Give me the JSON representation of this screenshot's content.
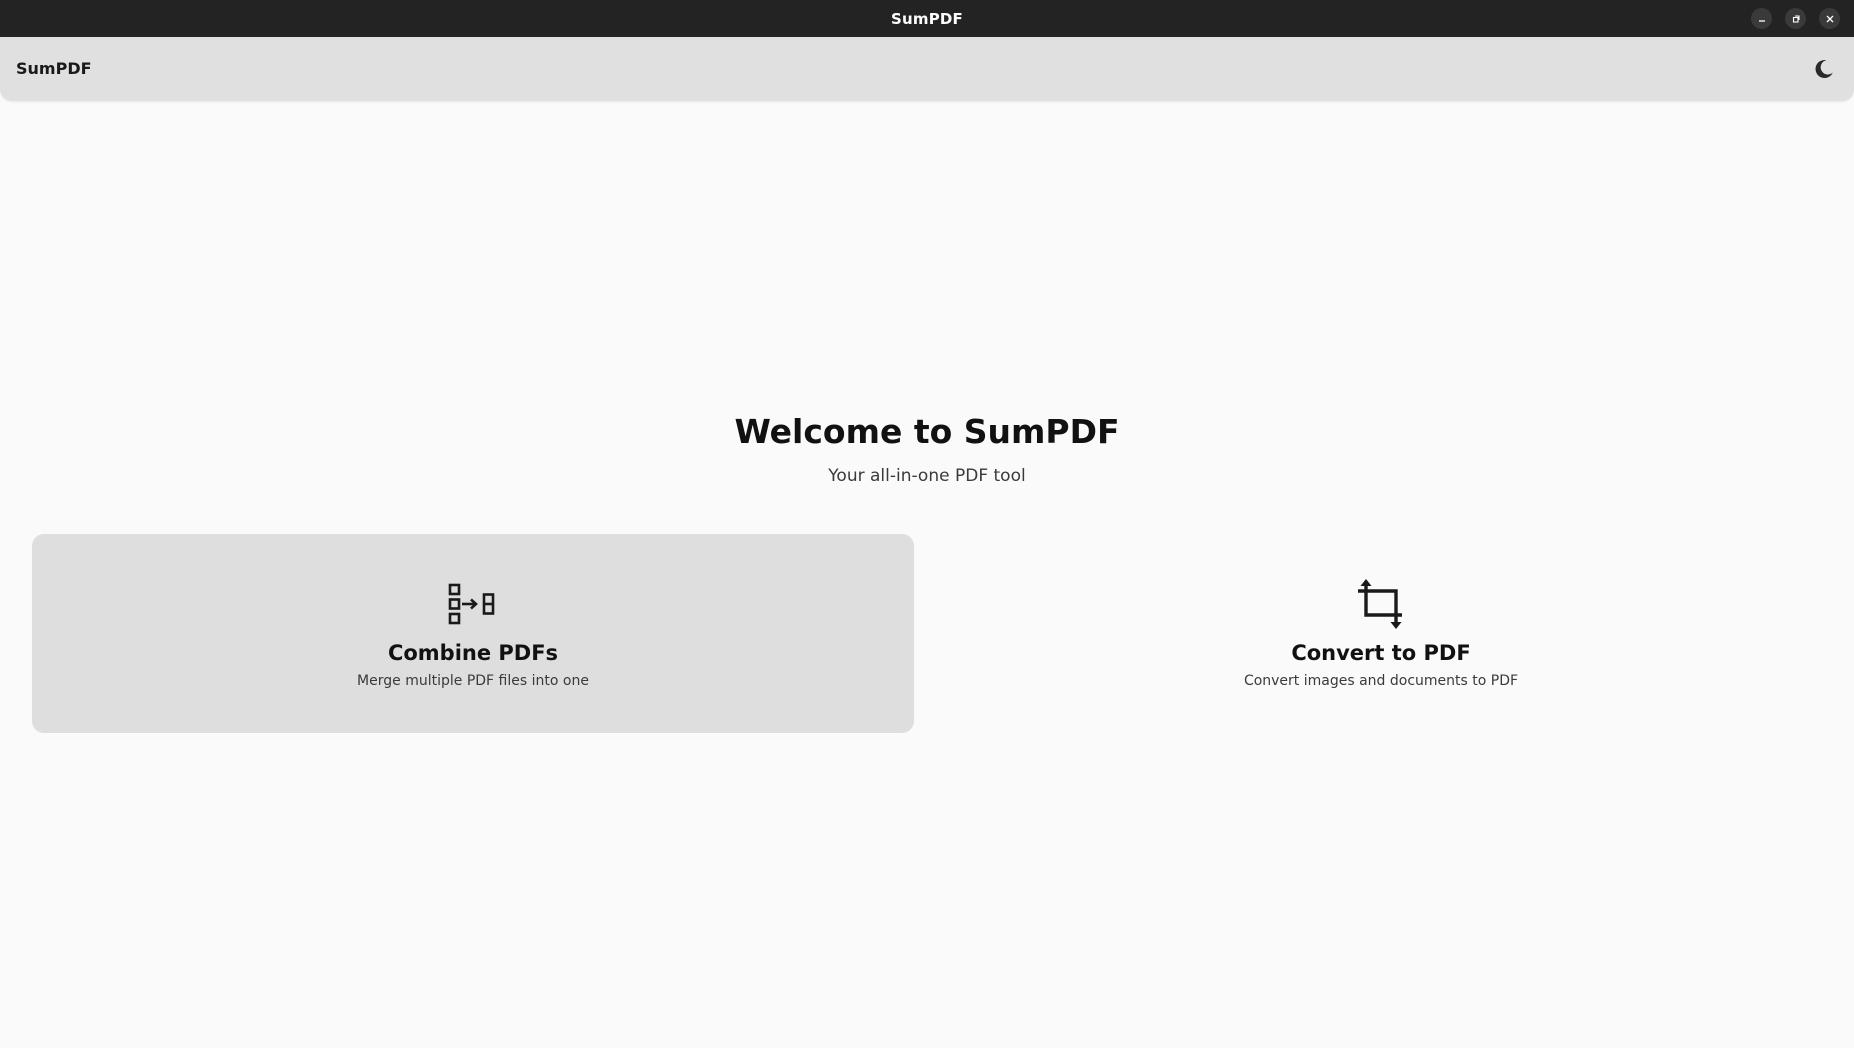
{
  "window": {
    "title": "SumPDF"
  },
  "header": {
    "app_name": "SumPDF",
    "theme_toggle_icon": "moon-icon"
  },
  "main": {
    "title": "Welcome to SumPDF",
    "subtitle": "Your all-in-one PDF tool",
    "cards": [
      {
        "title": "Combine PDFs",
        "description": "Merge multiple PDF files into one",
        "icon": "combine-icon"
      },
      {
        "title": "Convert to PDF",
        "description": "Convert images and documents to PDF",
        "icon": "crop-convert-icon"
      }
    ]
  },
  "colors": {
    "titlebar_bg": "#232323",
    "headerbar_bg": "#e0e0e0",
    "page_bg": "#fafafa",
    "card_hover_bg": "#dedede"
  }
}
